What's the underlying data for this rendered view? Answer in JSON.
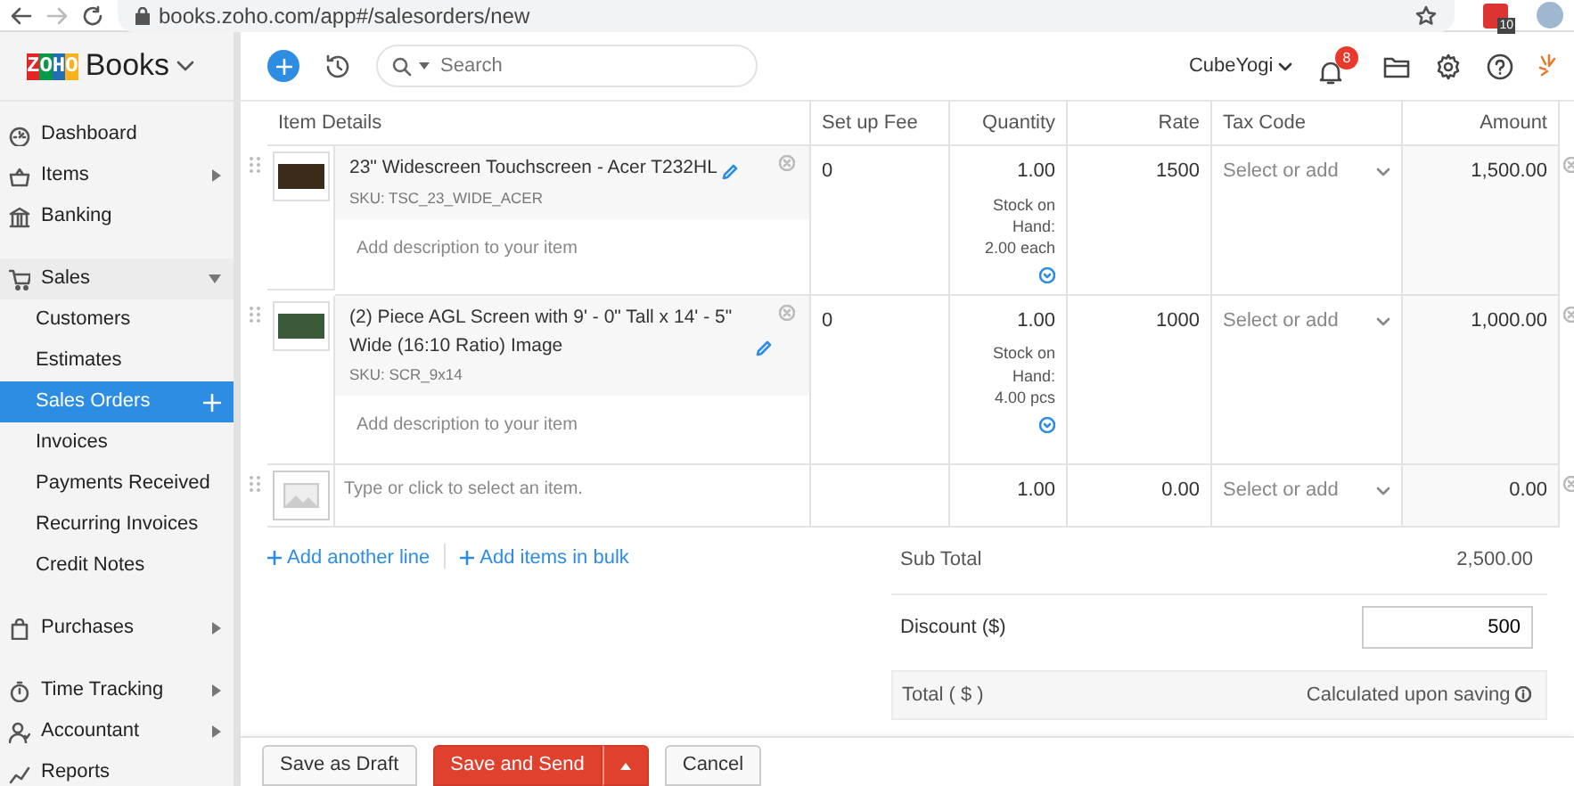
{
  "browser": {
    "url": "books.zoho.com/app#/salesorders/new",
    "extension_badge": "10"
  },
  "app": {
    "brand": "ZOHO",
    "product": "Books",
    "search_placeholder": "Search",
    "organization": "CubeYogi",
    "notification_count": "8"
  },
  "sidebar": {
    "groups": [
      [
        {
          "label": "Dashboard",
          "selected": false
        },
        {
          "label": "Items",
          "selected": false,
          "expanded": false
        },
        {
          "label": "Banking",
          "selected": false
        }
      ],
      [
        {
          "label": "Sales",
          "selected": false,
          "expanded": true,
          "children": [
            {
              "label": "Customers",
              "selected": false
            },
            {
              "label": "Estimates",
              "selected": false
            },
            {
              "label": "Sales Orders",
              "selected": true
            },
            {
              "label": "Invoices",
              "selected": false
            },
            {
              "label": "Payments Received",
              "selected": false
            },
            {
              "label": "Recurring Invoices",
              "selected": false
            },
            {
              "label": "Credit Notes",
              "selected": false
            }
          ]
        }
      ],
      [
        {
          "label": "Purchases",
          "selected": false,
          "expanded": false
        }
      ],
      [
        {
          "label": "Time Tracking",
          "selected": false,
          "expanded": false
        },
        {
          "label": "Accountant",
          "selected": false,
          "expanded": false
        },
        {
          "label": "Reports",
          "selected": false
        }
      ]
    ]
  },
  "table": {
    "columns": [
      "Item Details",
      "Set up Fee",
      "Quantity",
      "Rate",
      "Tax Code",
      "Amount"
    ],
    "rows": [
      {
        "kind": "item",
        "name": "23\" Widescreen Touchscreen - Acer T232HL",
        "sku": "SKU: TSC_23_WIDE_ACER",
        "description_placeholder": "Add description to your item",
        "setup_fee": "0",
        "quantity": "1.00",
        "stock": "Stock on Hand: 2.00 each",
        "rate": "1500",
        "tax_placeholder": "Select or add",
        "amount": "1,500.00"
      },
      {
        "kind": "item",
        "name": "(2) Piece AGL Screen with 9' - 0\" Tall x 14' - 5\" Wide (16:10 Ratio) Image",
        "sku": "SKU: SCR_9x14",
        "description_placeholder": "Add description to your item",
        "setup_fee": "0",
        "quantity": "1.00",
        "stock": "Stock on Hand: 4.00 pcs",
        "rate": "1000",
        "tax_placeholder": "Select or add",
        "amount": "1,000.00"
      },
      {
        "kind": "new",
        "placeholder": "Type or click to select an item.",
        "quantity": "1.00",
        "rate": "0.00",
        "tax_placeholder": "Select or add",
        "amount": "0.00"
      }
    ]
  },
  "links": [
    "Add another line",
    "Add items in bulk"
  ],
  "totals": {
    "sub_total_label": "Sub Total",
    "sub_total": "2,500.00",
    "discount_label": "Discount ($)",
    "discount": "500",
    "total_label": "Total ( $ )",
    "total_note": "Calculated upon saving"
  },
  "buttons": {
    "save_draft": "Save as Draft",
    "save_send": "Save and Send",
    "cancel": "Cancel"
  }
}
